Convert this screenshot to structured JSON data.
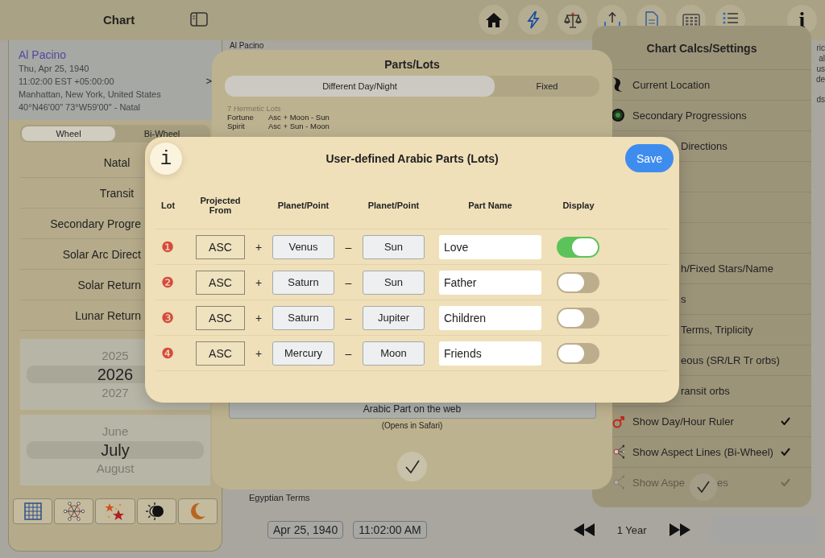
{
  "top_bar": {
    "title": "Chart"
  },
  "chart_info": {
    "name": "Al Pacino",
    "lines": [
      "Thu, Apr 25, 1940",
      "11:02:00 EST +05:00:00",
      "Manhattan, New York, United States",
      "40°N46'00\" 73°W59'00\" - Natal"
    ],
    "chevron": ">"
  },
  "wheel_tabs": [
    {
      "label": "Wheel",
      "selected": true
    },
    {
      "label": "Bi-Wheel",
      "selected": false
    }
  ],
  "chart_types": [
    "Natal",
    "Transit",
    "Secondary Progre",
    "Solar Arc Direct",
    "Solar Return",
    "Lunar Return"
  ],
  "year_picker": [
    "2025",
    "2026",
    "2027"
  ],
  "month_picker": [
    "June",
    "July",
    "August"
  ],
  "background_texts": {
    "chart_name": "Al Pacino",
    "terms": "Egyptian Terms",
    "edge_fragments": [
      "ric",
      "al",
      "us",
      "de",
      "ds"
    ]
  },
  "bottom_bar": {
    "date": "Apr 25, 1940",
    "time": "11:02:00 AM",
    "step": "1 Year"
  },
  "settings_panel": {
    "title": "Chart Calcs/Settings",
    "items": [
      {
        "kind": "item",
        "label": "Current Location",
        "checked": false,
        "disabled": false
      },
      {
        "kind": "item",
        "label": "Secondary Progressions",
        "checked": false,
        "disabled": false
      },
      {
        "kind": "item",
        "label": "Directions",
        "checked": false,
        "disabled": false
      },
      {
        "kind": "blank"
      },
      {
        "kind": "blank"
      },
      {
        "kind": "blank"
      },
      {
        "kind": "item",
        "label": "h/Fixed Stars/Name",
        "checked": false,
        "disabled": false
      },
      {
        "kind": "item",
        "label": "s",
        "checked": false,
        "disabled": false
      },
      {
        "kind": "item",
        "label": "Terms, Triplicity",
        "checked": false,
        "disabled": false
      },
      {
        "kind": "item",
        "label": "eous (SR/LR Tr orbs)",
        "checked": false,
        "disabled": false
      },
      {
        "kind": "item",
        "label": "ransit orbs",
        "checked": false,
        "disabled": false
      },
      {
        "kind": "item",
        "label": "Show Day/Hour Ruler",
        "checked": true,
        "disabled": false
      },
      {
        "kind": "item",
        "label": "Show Aspect Lines (Bi-Wheel)",
        "checked": true,
        "disabled": false
      },
      {
        "kind": "item",
        "label": "Show Aspe",
        "label_end": "es",
        "checked": true,
        "disabled": true
      }
    ]
  },
  "parts_sheet": {
    "title": "Parts/Lots",
    "tabs": [
      {
        "label": "Different Day/Night",
        "selected": true
      },
      {
        "label": "Fixed",
        "selected": false
      }
    ],
    "section": "7 Hermetic Lots",
    "lots": [
      {
        "name": "Fortune",
        "formula": "Asc + Moon - Sun"
      },
      {
        "name": "Spirit",
        "formula": "Asc + Sun - Moon"
      }
    ],
    "web_button": "Arabic Part on the web",
    "web_note": "(Opens in Safari)"
  },
  "dialog": {
    "title": "User-defined Arabic Parts (Lots)",
    "save": "Save",
    "info": "i",
    "columns": [
      "Lot",
      "Projected From",
      "Planet/Point",
      "Planet/Point",
      "Part Name",
      "Display"
    ],
    "rows": [
      {
        "number": "❶",
        "from": "ASC",
        "op1": "+",
        "planet1": "Venus",
        "op2": "–",
        "planet2": "Sun",
        "name": "Love",
        "on": true
      },
      {
        "number": "❷",
        "from": "ASC",
        "op1": "+",
        "planet1": "Saturn",
        "op2": "–",
        "planet2": "Sun",
        "name": "Father",
        "on": false
      },
      {
        "number": "❸",
        "from": "ASC",
        "op1": "+",
        "planet1": "Saturn",
        "op2": "–",
        "planet2": "Jupiter",
        "name": "Children",
        "on": false
      },
      {
        "number": "❹",
        "from": "ASC",
        "op1": "+",
        "planet1": "Mercury",
        "op2": "–",
        "planet2": "Moon",
        "name": "Friends",
        "on": false
      }
    ]
  },
  "info_button": "i"
}
